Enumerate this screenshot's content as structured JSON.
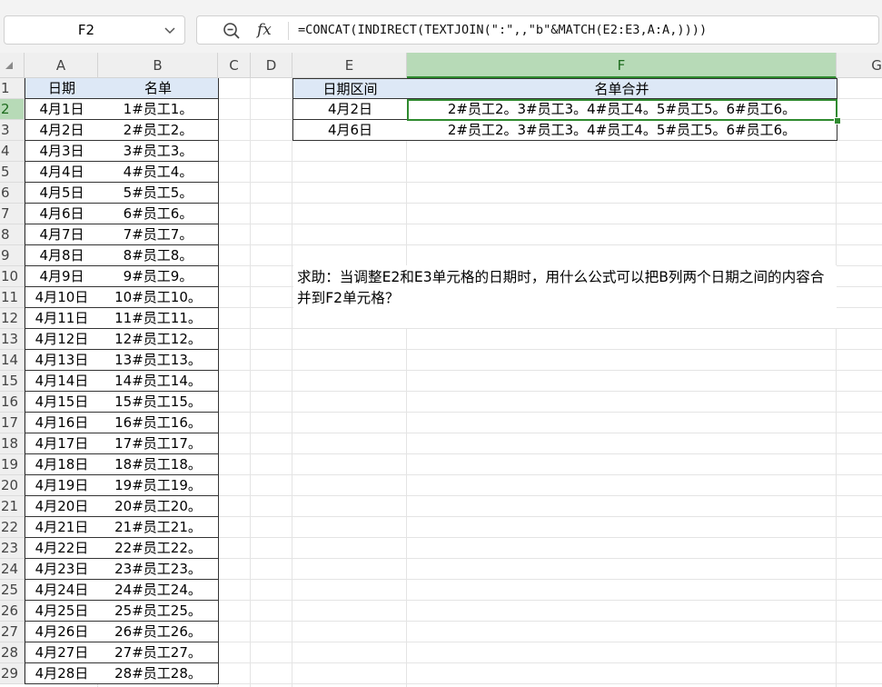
{
  "name_box": {
    "value": "F2"
  },
  "formula_bar": {
    "fx_label": "fx",
    "formula": "=CONCAT(INDIRECT(TEXTJOIN(\":\",,\"b\"&MATCH(E2:E3,A:A,))))"
  },
  "columns": [
    "A",
    "B",
    "C",
    "D",
    "E",
    "F",
    "G"
  ],
  "rows": [
    "1",
    "2",
    "3",
    "4",
    "5",
    "6",
    "7",
    "8",
    "9",
    "10",
    "11",
    "12",
    "13",
    "14",
    "15",
    "16",
    "17",
    "18",
    "19",
    "20",
    "21",
    "22",
    "23",
    "24",
    "25",
    "26",
    "27",
    "28",
    "29"
  ],
  "table_ab": {
    "headers": [
      "日期",
      "名单"
    ],
    "rows": [
      [
        "4月1日",
        "1#员工1。"
      ],
      [
        "4月2日",
        "2#员工2。"
      ],
      [
        "4月3日",
        "3#员工3。"
      ],
      [
        "4月4日",
        "4#员工4。"
      ],
      [
        "4月5日",
        "5#员工5。"
      ],
      [
        "4月6日",
        "6#员工6。"
      ],
      [
        "4月7日",
        "7#员工7。"
      ],
      [
        "4月8日",
        "8#员工8。"
      ],
      [
        "4月9日",
        "9#员工9。"
      ],
      [
        "4月10日",
        "10#员工10。"
      ],
      [
        "4月11日",
        "11#员工11。"
      ],
      [
        "4月12日",
        "12#员工12。"
      ],
      [
        "4月13日",
        "13#员工13。"
      ],
      [
        "4月14日",
        "14#员工14。"
      ],
      [
        "4月15日",
        "15#员工15。"
      ],
      [
        "4月16日",
        "16#员工16。"
      ],
      [
        "4月17日",
        "17#员工17。"
      ],
      [
        "4月18日",
        "18#员工18。"
      ],
      [
        "4月19日",
        "19#员工19。"
      ],
      [
        "4月20日",
        "20#员工20。"
      ],
      [
        "4月21日",
        "21#员工21。"
      ],
      [
        "4月22日",
        "22#员工22。"
      ],
      [
        "4月23日",
        "23#员工23。"
      ],
      [
        "4月24日",
        "24#员工24。"
      ],
      [
        "4月25日",
        "25#员工25。"
      ],
      [
        "4月26日",
        "26#员工26。"
      ],
      [
        "4月27日",
        "27#员工27。"
      ],
      [
        "4月28日",
        "28#员工28。"
      ]
    ]
  },
  "table_ef": {
    "headers": [
      "日期区间",
      "名单合并"
    ],
    "rows": [
      [
        "4月2日",
        "2#员工2。3#员工3。4#员工4。5#员工5。6#员工6。"
      ],
      [
        "4月6日",
        "2#员工2。3#员工3。4#员工4。5#员工5。6#员工6。"
      ]
    ]
  },
  "note": {
    "text": "求助：当调整E2和E3单元格的日期时，用什么公式可以把B列两个日期之间的内容合并到F2单元格？"
  }
}
